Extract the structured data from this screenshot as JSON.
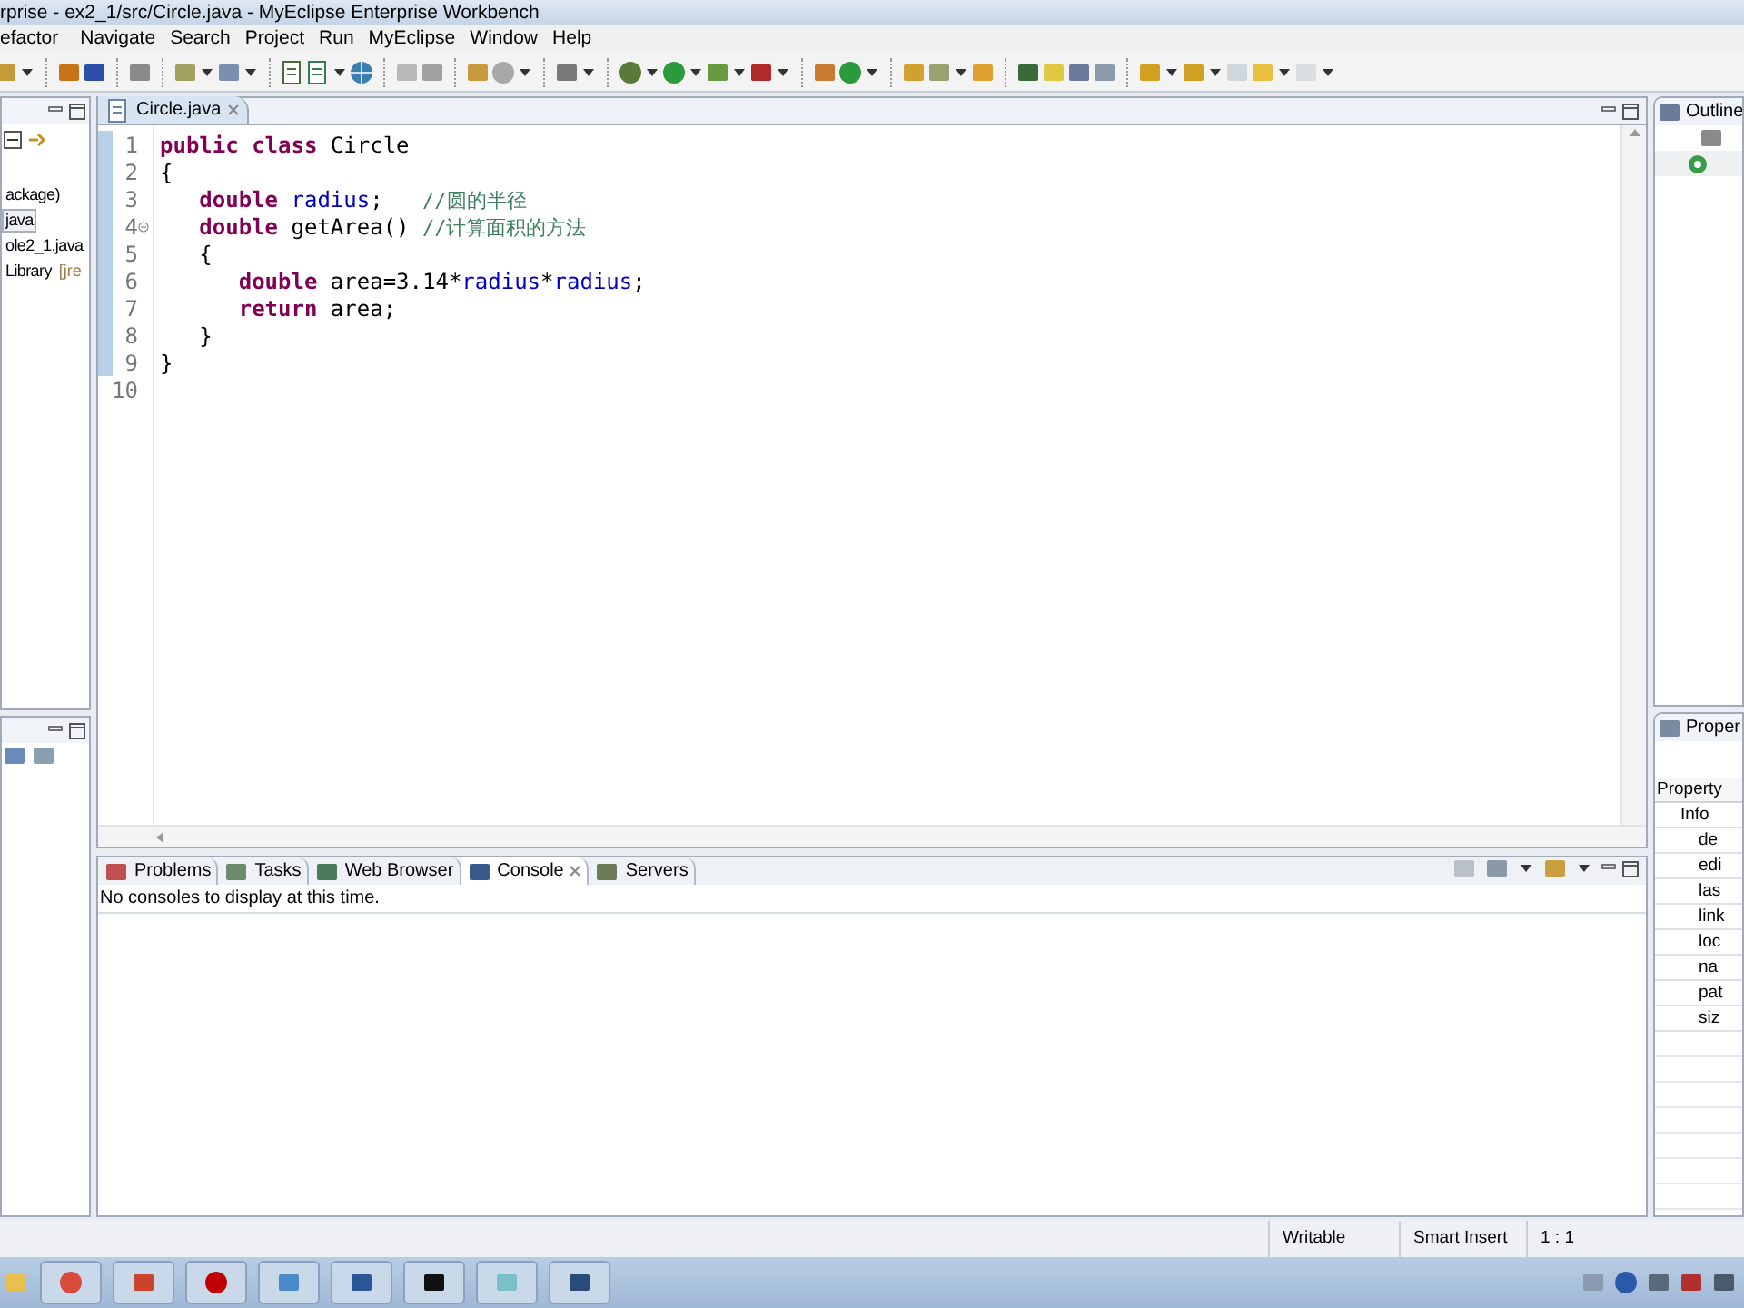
{
  "window": {
    "title": "rprise - ex2_1/src/Circle.java - MyEclipse Enterprise Workbench"
  },
  "menu": [
    "efactor",
    "Navigate",
    "Search",
    "Project",
    "Run",
    "MyEclipse",
    "Window",
    "Help"
  ],
  "left_panel": {
    "items": [
      {
        "label": "ackage)",
        "selected": false
      },
      {
        "label": "java",
        "selected": true
      },
      {
        "label": "ole2_1.java",
        "selected": false
      },
      {
        "label": "Library",
        "suffix": "[jre",
        "selected": false
      }
    ]
  },
  "editor": {
    "tabs": [
      {
        "label": "Circle.java",
        "selected": true
      }
    ],
    "lines": [
      {
        "number": "1",
        "fold": false,
        "tokens": [
          {
            "kind": "keyword",
            "text": "public class "
          },
          {
            "kind": "plain",
            "text": "Circle"
          }
        ]
      },
      {
        "number": "2",
        "fold": false,
        "tokens": [
          {
            "kind": "plain",
            "text": "{"
          }
        ]
      },
      {
        "number": "3",
        "fold": false,
        "tokens": [
          {
            "kind": "keyword",
            "text": "   double "
          },
          {
            "kind": "field",
            "text": "radius"
          },
          {
            "kind": "plain",
            "text": ";   "
          },
          {
            "kind": "comment",
            "text": "//圆的半径"
          }
        ]
      },
      {
        "number": "4",
        "fold": true,
        "tokens": [
          {
            "kind": "keyword",
            "text": "   double "
          },
          {
            "kind": "plain",
            "text": "getArea() "
          },
          {
            "kind": "comment",
            "text": "//计算面积的方法"
          }
        ]
      },
      {
        "number": "5",
        "fold": false,
        "tokens": [
          {
            "kind": "plain",
            "text": "   {"
          }
        ]
      },
      {
        "number": "6",
        "fold": false,
        "tokens": [
          {
            "kind": "keyword",
            "text": "      double "
          },
          {
            "kind": "plain",
            "text": "area=3.14*"
          },
          {
            "kind": "field",
            "text": "radius"
          },
          {
            "kind": "plain",
            "text": "*"
          },
          {
            "kind": "field",
            "text": "radius"
          },
          {
            "kind": "plain",
            "text": ";"
          }
        ]
      },
      {
        "number": "7",
        "fold": false,
        "tokens": [
          {
            "kind": "keyword",
            "text": "      return "
          },
          {
            "kind": "plain",
            "text": "area;"
          }
        ]
      },
      {
        "number": "8",
        "fold": false,
        "tokens": [
          {
            "kind": "plain",
            "text": "   }"
          }
        ]
      },
      {
        "number": "9",
        "fold": false,
        "tokens": [
          {
            "kind": "plain",
            "text": "}"
          }
        ]
      },
      {
        "number": "10",
        "fold": false
      }
    ]
  },
  "bottom_panel": {
    "tabs": [
      {
        "label": "Problems",
        "selected": false
      },
      {
        "label": "Tasks",
        "selected": false
      },
      {
        "label": "Web Browser",
        "selected": false
      },
      {
        "label": "Console",
        "selected": true
      },
      {
        "label": "Servers",
        "selected": false
      }
    ],
    "message": "No consoles to display at this time."
  },
  "right_panel": {
    "outline_title": "Outline",
    "properties_title": "Proper",
    "column": "Property",
    "group": "Info",
    "rows": [
      "de",
      "edi",
      "las",
      "link",
      "loc",
      "na",
      "pat",
      "siz"
    ]
  },
  "status_bar": [
    "Writable",
    "Smart Insert",
    "1 : 1"
  ]
}
